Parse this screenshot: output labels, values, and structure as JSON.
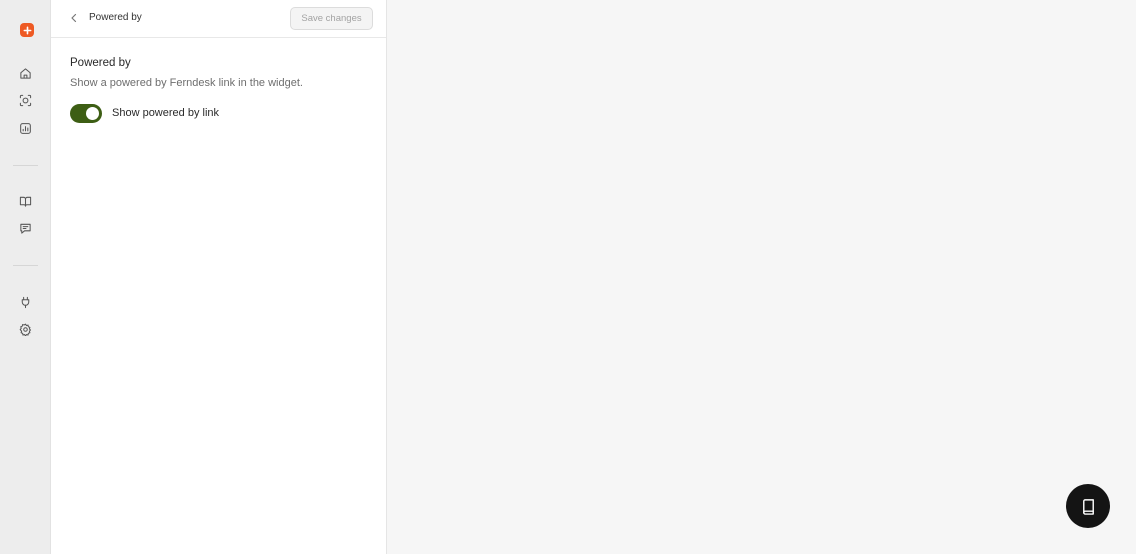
{
  "nav": {
    "items": [
      {
        "icon": "home-icon"
      },
      {
        "icon": "scan-face-icon"
      },
      {
        "icon": "analytics-icon"
      },
      {
        "icon": "book-icon"
      },
      {
        "icon": "chat-icon"
      },
      {
        "icon": "plug-icon"
      },
      {
        "icon": "gear-icon"
      }
    ]
  },
  "header": {
    "title": "Powered by",
    "save_label": "Save changes"
  },
  "section": {
    "title": "Powered by",
    "description": "Show a powered by Ferndesk link in the widget.",
    "toggle_label": "Show powered by link",
    "toggle_on": true
  },
  "colors": {
    "brand": "#ee5a24",
    "toggle_on": "#3d5e14",
    "fab": "#141414"
  }
}
